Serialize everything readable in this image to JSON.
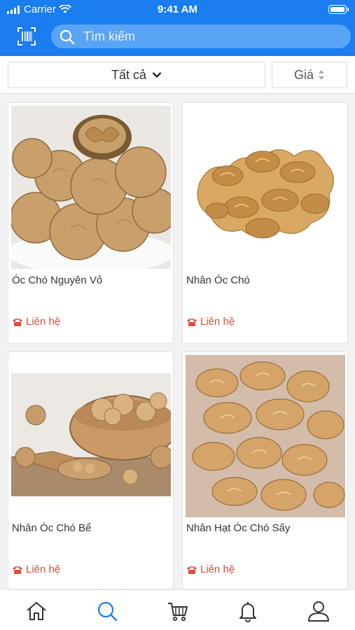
{
  "status_bar": {
    "carrier": "Carrier",
    "time": "9:41 AM"
  },
  "search": {
    "placeholder": "Tìm kiếm"
  },
  "filters": {
    "category_label": "Tất cả",
    "price_label": "Giá"
  },
  "products": [
    {
      "name": "Óc Chó Nguyên Vỏ",
      "contact": "Liên hệ"
    },
    {
      "name": "Nhân Óc Chó",
      "contact": "Liên hệ"
    },
    {
      "name": "Nhân Óc Chó Bể",
      "contact": "Liên hệ"
    },
    {
      "name": "Nhân Hạt Óc Chó Sấy",
      "contact": "Liên hệ"
    }
  ],
  "tabs": [
    "home-icon",
    "search-icon",
    "cart-icon",
    "bell-icon",
    "user-icon"
  ],
  "colors": {
    "primary": "#1a7df0",
    "accent": "#e24a3b",
    "active_tab": "#1a7df0"
  }
}
